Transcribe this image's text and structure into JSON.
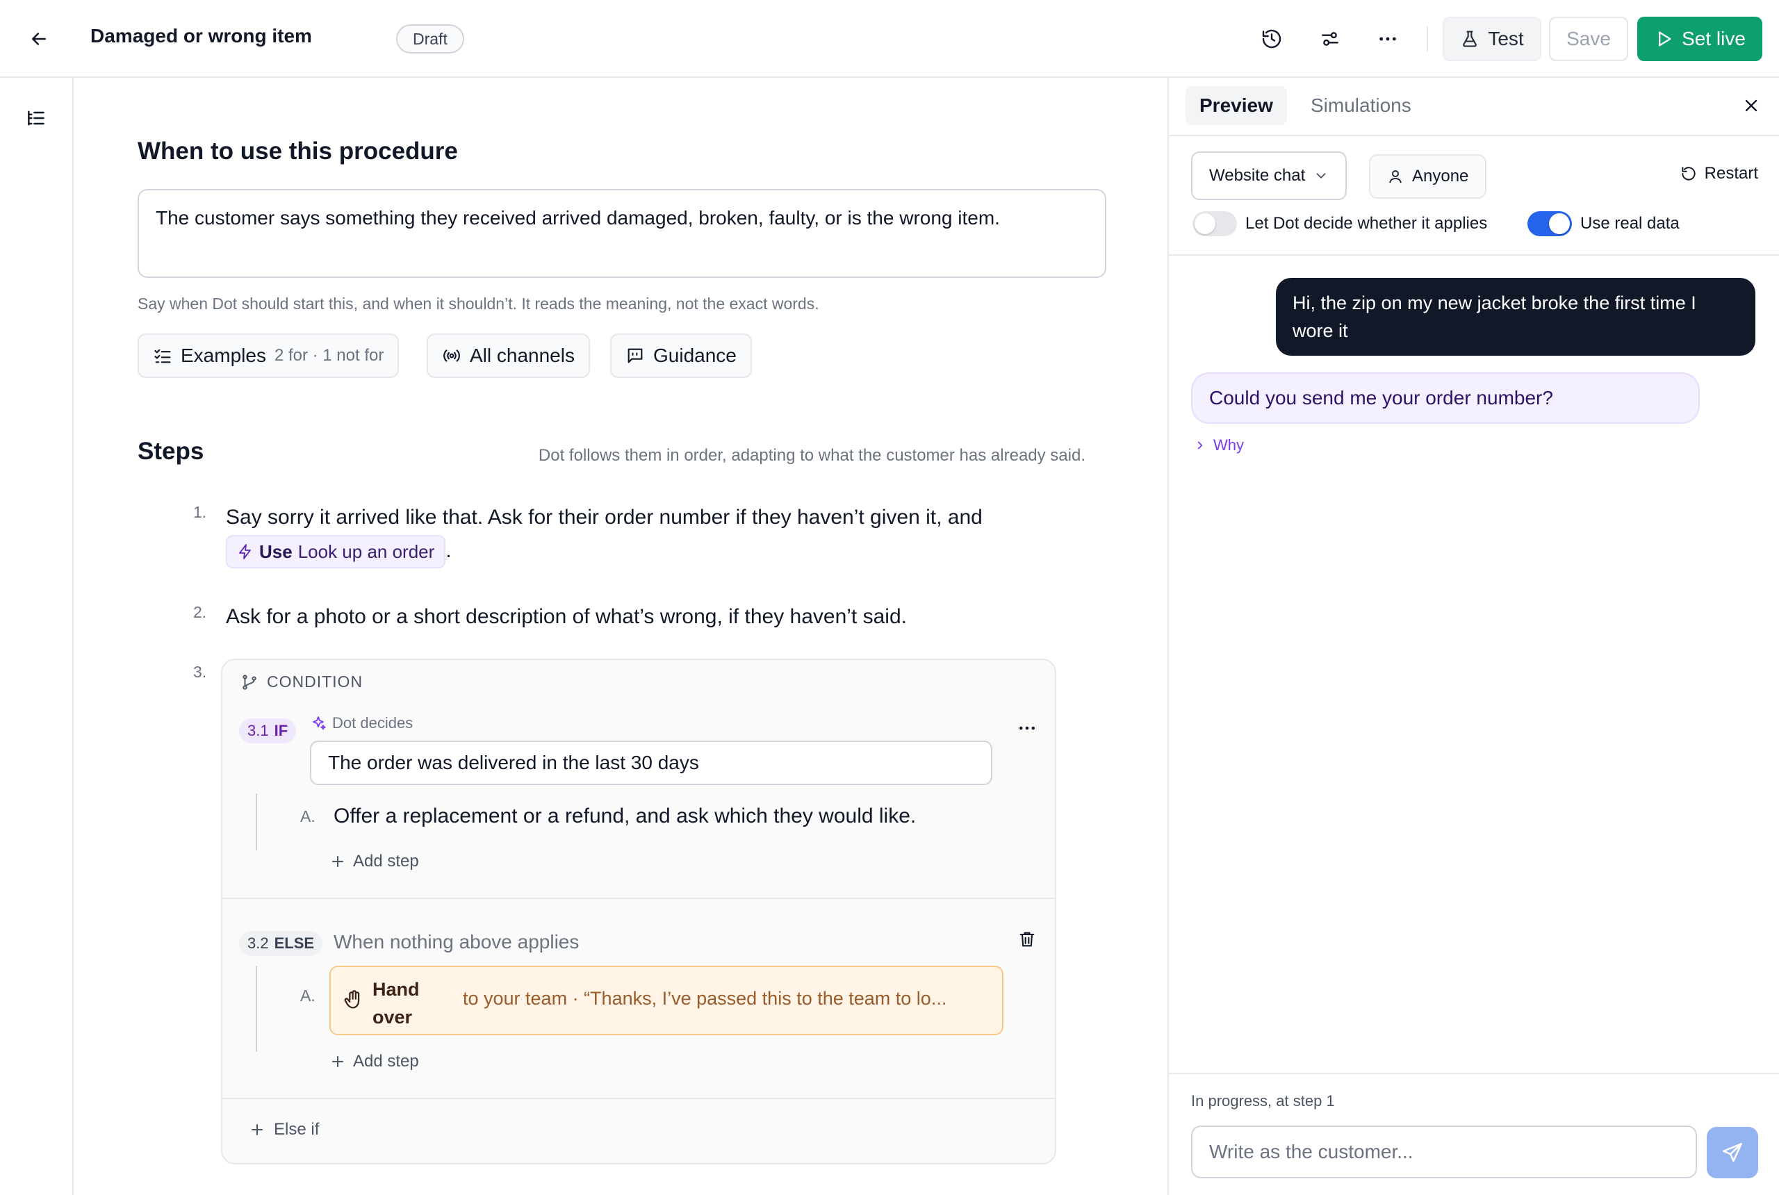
{
  "header": {
    "title": "Damaged or wrong item",
    "status": "Draft",
    "test_label": "Test",
    "save_label": "Save",
    "set_live_label": "Set live",
    "accent_color": "#0e9f6e"
  },
  "trigger": {
    "section_title": "When to use this procedure",
    "text": "The customer says something they received arrived damaged, broken, faulty, or is the wrong item.",
    "hint": "Say when Dot should start this, and when it shouldn’t. It reads the meaning, not the exact words.",
    "chips": {
      "examples_label": "Examples",
      "examples_count": "2 for · 1 not for",
      "channels_label": "All channels",
      "guidance_label": "Guidance"
    }
  },
  "steps": {
    "section_title": "Steps",
    "hint": "Dot follows them in order, adapting to what the customer has already said.",
    "items": [
      {
        "number": "1.",
        "text": "Say sorry it arrived like that. Ask for their order number if they haven’t given it, and",
        "tool_prefix": "Use",
        "tool_name": "Look up an order",
        "suffix": "."
      },
      {
        "number": "2.",
        "text": "Ask for a photo or a short description of what’s wrong, if they haven’t said."
      },
      {
        "number": "3."
      }
    ],
    "condition": {
      "label": "CONDITION",
      "if_branch": {
        "num": "3.1",
        "keyword": "IF",
        "decider": "Dot decides",
        "condition_text": "The order was delivered in the last 30 days",
        "sub_letter": "A.",
        "sub_text": "Offer a replacement or a refund, and ask which they would like.",
        "add_step": "Add step"
      },
      "else_branch": {
        "num": "3.2",
        "keyword": "ELSE",
        "text": "When nothing above applies",
        "sub_letter": "A.",
        "handover_title": "Hand over",
        "handover_desc": "to your team · “Thanks, I’ve passed this to the team to lo...",
        "add_step": "Add step"
      },
      "else_if": "Else if"
    }
  },
  "preview": {
    "tabs": [
      "Preview",
      "Simulations"
    ],
    "channel": "Website chat",
    "audience": "Anyone",
    "restart": "Restart",
    "toggle_applies": {
      "label": "Let Dot decide whether it applies",
      "on": false
    },
    "toggle_real_data": {
      "label": "Use real data",
      "on": true
    },
    "messages": [
      {
        "from": "customer",
        "text": "Hi, the zip on my new jacket broke the first time I wore it"
      },
      {
        "from": "dot",
        "text": "Could you send me your order number?"
      }
    ],
    "why_label": "Why",
    "progress": "In progress, at step 1",
    "compose_placeholder": "Write as the customer..."
  }
}
